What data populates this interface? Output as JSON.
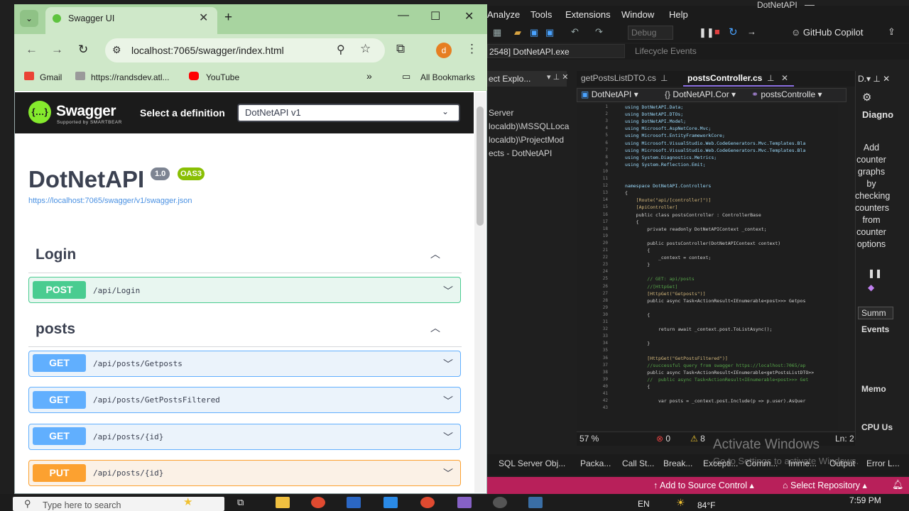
{
  "visual_studio": {
    "title": "DotNetAPI",
    "menu": [
      "Analyze",
      "Tools",
      "Extensions",
      "Window",
      "Help"
    ],
    "toolbar": {
      "debug_label": "Debug",
      "copilot_label": "GitHub Copilot"
    },
    "process_label": "2548] DotNetAPI.exe",
    "lifecycle_label": "Lifecycle Events",
    "solution_explorer": {
      "tab_label": "ect Explo...",
      "items": [
        "Server",
        "localdb)\\MSSQLLoca",
        "localdb)\\ProjectMod",
        "ects - DotNetAPI"
      ]
    },
    "editor": {
      "tabs": [
        {
          "label": "getPostsListDTO.cs",
          "active": false
        },
        {
          "label": "postsController.cs",
          "active": true
        }
      ],
      "nav": [
        "DotNetAPI",
        "DotNetAPI.Cor",
        "postsControlle"
      ],
      "lines": [
        {
          "n": "1",
          "t": "using DotNetAPI.Data;"
        },
        {
          "n": "2",
          "t": "using DotNetAPI.DTOs;"
        },
        {
          "n": "3",
          "t": "using DotNetAPI.Model;"
        },
        {
          "n": "4",
          "t": "using Microsoft.AspNetCore.Mvc;"
        },
        {
          "n": "5",
          "t": "using Microsoft.EntityFrameworkCore;"
        },
        {
          "n": "6",
          "t": "using Microsoft.VisualStudio.Web.CodeGenerators.Mvc.Templates.Bla"
        },
        {
          "n": "7",
          "t": "using Microsoft.VisualStudio.Web.CodeGenerators.Mvc.Templates.Bla"
        },
        {
          "n": "8",
          "t": "using System.Diagnostics.Metrics;"
        },
        {
          "n": "9",
          "t": "using System.Reflection.Emit;"
        },
        {
          "n": "10",
          "t": ""
        },
        {
          "n": "11",
          "t": ""
        },
        {
          "n": "12",
          "t": "namespace DotNetAPI.Controllers"
        },
        {
          "n": "13",
          "t": "{"
        },
        {
          "n": "14",
          "t": "    [Route(\"api/[controller]\")]"
        },
        {
          "n": "15",
          "t": "    [ApiController]"
        },
        {
          "n": "16",
          "t": "    public class postsController : ControllerBase"
        },
        {
          "n": "17",
          "t": "    {"
        },
        {
          "n": "18",
          "t": "        private readonly DotNetAPIContext _context;"
        },
        {
          "n": "19",
          "t": ""
        },
        {
          "n": "20",
          "t": "        public postsController(DotNetAPIContext context)"
        },
        {
          "n": "21",
          "t": "        {"
        },
        {
          "n": "22",
          "t": "            _context = context;"
        },
        {
          "n": "23",
          "t": "        }"
        },
        {
          "n": "24",
          "t": ""
        },
        {
          "n": "25",
          "t": "        // GET: api/posts"
        },
        {
          "n": "26",
          "t": "        //[HttpGet]"
        },
        {
          "n": "27",
          "t": "        [HttpGet(\"Getposts\")]"
        },
        {
          "n": "28",
          "t": "        public async Task<ActionResult<IEnumerable<post>>> Getpos"
        },
        {
          "n": "29",
          "t": ""
        },
        {
          "n": "30",
          "t": "        {"
        },
        {
          "n": "31",
          "t": ""
        },
        {
          "n": "32",
          "t": "            return await _context.post.ToListAsync();"
        },
        {
          "n": "33",
          "t": ""
        },
        {
          "n": "34",
          "t": "        }"
        },
        {
          "n": "35",
          "t": ""
        },
        {
          "n": "36",
          "t": "        [HttpGet(\"GetPostsFiltered\")]"
        },
        {
          "n": "37",
          "t": "        //successful query from swagger https://localhost:7065/ap"
        },
        {
          "n": "38",
          "t": "        public async Task<ActionResult<IEnumerable<getPostsListDTO>>"
        },
        {
          "n": "39",
          "t": "        //  public async Task<ActionResult<IEnumerable<post>>> Get"
        },
        {
          "n": "40",
          "t": "        {"
        },
        {
          "n": "41",
          "t": ""
        },
        {
          "n": "42",
          "t": "            var posts = _context.post.Include(p => p.user).AsQuer"
        },
        {
          "n": "43",
          "t": ""
        }
      ],
      "zoom": "57 %",
      "errors": "0",
      "warnings": "8",
      "position": "Ln: 2"
    },
    "diagnostics": {
      "title": "Diagno",
      "note": "Add counter graphs by checking counters from counter options",
      "summary_tab": "Summ",
      "sections": [
        "Events",
        "Memo",
        "CPU Us"
      ]
    },
    "bottom_tabs": [
      "SQL Server Obj...",
      "Packa...",
      "Call St...",
      "Break...",
      "Excepti...",
      "Comm...",
      "Imme...",
      "Output",
      "Error L..."
    ],
    "watermark": {
      "title": "Activate Windows",
      "subtitle": "Go to Settings to activate Windows."
    },
    "statusbar": {
      "add_source": "Add to Source Control",
      "select_repo": "Select Repository"
    }
  },
  "taskbar": {
    "search_placeholder": "Type here to search",
    "language": "EN",
    "temperature": "84°F",
    "time": "7:59 PM"
  },
  "chrome": {
    "tab_title": "Swagger UI",
    "url": "localhost:7065/swagger/index.html",
    "profile_initial": "d",
    "bookmarks": [
      "Gmail",
      "https://randsdev.atl...",
      "YouTube"
    ],
    "all_bookmarks": "All Bookmarks"
  },
  "swagger": {
    "brand": "Swagger",
    "brand_sub": "Supported by SMARTBEAR",
    "definition_label": "Select a definition",
    "definition_value": "DotNetAPI v1",
    "api_title": "DotNetAPI",
    "version": "1.0",
    "oas": "OAS3",
    "spec_url": "https://localhost:7065/swagger/v1/swagger.json",
    "sections": [
      {
        "name": "Login",
        "ops": [
          {
            "method": "POST",
            "path": "/api/Login"
          }
        ]
      },
      {
        "name": "posts",
        "ops": [
          {
            "method": "GET",
            "path": "/api/posts/Getposts"
          },
          {
            "method": "GET",
            "path": "/api/posts/GetPostsFiltered"
          },
          {
            "method": "GET",
            "path": "/api/posts/{id}"
          },
          {
            "method": "PUT",
            "path": "/api/posts/{id}"
          }
        ]
      }
    ],
    "colors": {
      "post": "#49cc90",
      "post_bg": "#e8f6f0",
      "get": "#61affe",
      "get_bg": "#ebf3fb",
      "put": "#fca130",
      "put_bg": "#fbf1e6"
    }
  }
}
